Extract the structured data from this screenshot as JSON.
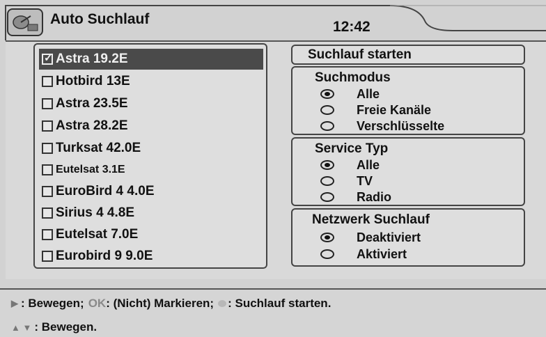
{
  "header": {
    "title": "Auto Suchlauf",
    "time": "12:42",
    "icon": "satellite-dish-icon"
  },
  "satellites": [
    {
      "label": "Astra 19.2E",
      "checked": true,
      "selected": true
    },
    {
      "label": "Hotbird 13E",
      "checked": false,
      "selected": false
    },
    {
      "label": "Astra 23.5E",
      "checked": false,
      "selected": false
    },
    {
      "label": "Astra 28.2E",
      "checked": false,
      "selected": false
    },
    {
      "label": "Turksat 42.0E",
      "checked": false,
      "selected": false
    },
    {
      "label": "Eutelsat 3.1E",
      "checked": false,
      "selected": false
    },
    {
      "label": "EuroBird 4 4.0E",
      "checked": false,
      "selected": false
    },
    {
      "label": "Sirius 4 4.8E",
      "checked": false,
      "selected": false
    },
    {
      "label": "Eutelsat 7.0E",
      "checked": false,
      "selected": false
    },
    {
      "label": "Eurobird 9 9.0E",
      "checked": false,
      "selected": false
    }
  ],
  "actions": {
    "start_label": "Suchlauf starten"
  },
  "search_mode": {
    "title": "Suchmodus",
    "options": [
      "Alle",
      "Freie Kanäle",
      "Verschlüsselte"
    ],
    "selected": "Alle"
  },
  "service_type": {
    "title": "Service Typ",
    "options": [
      "Alle",
      "TV",
      "Radio"
    ],
    "selected": "Alle"
  },
  "network_search": {
    "title": "Netzwerk Suchlauf",
    "options": [
      "Deaktiviert",
      "Aktiviert"
    ],
    "selected": "Deaktiviert"
  },
  "footer": {
    "move_label": ": Bewegen;",
    "ok_key": "OK",
    "mark_label": ": (Nicht) Markieren;",
    "start_label": ": Suchlauf starten.",
    "updown_label": ": Bewegen."
  }
}
